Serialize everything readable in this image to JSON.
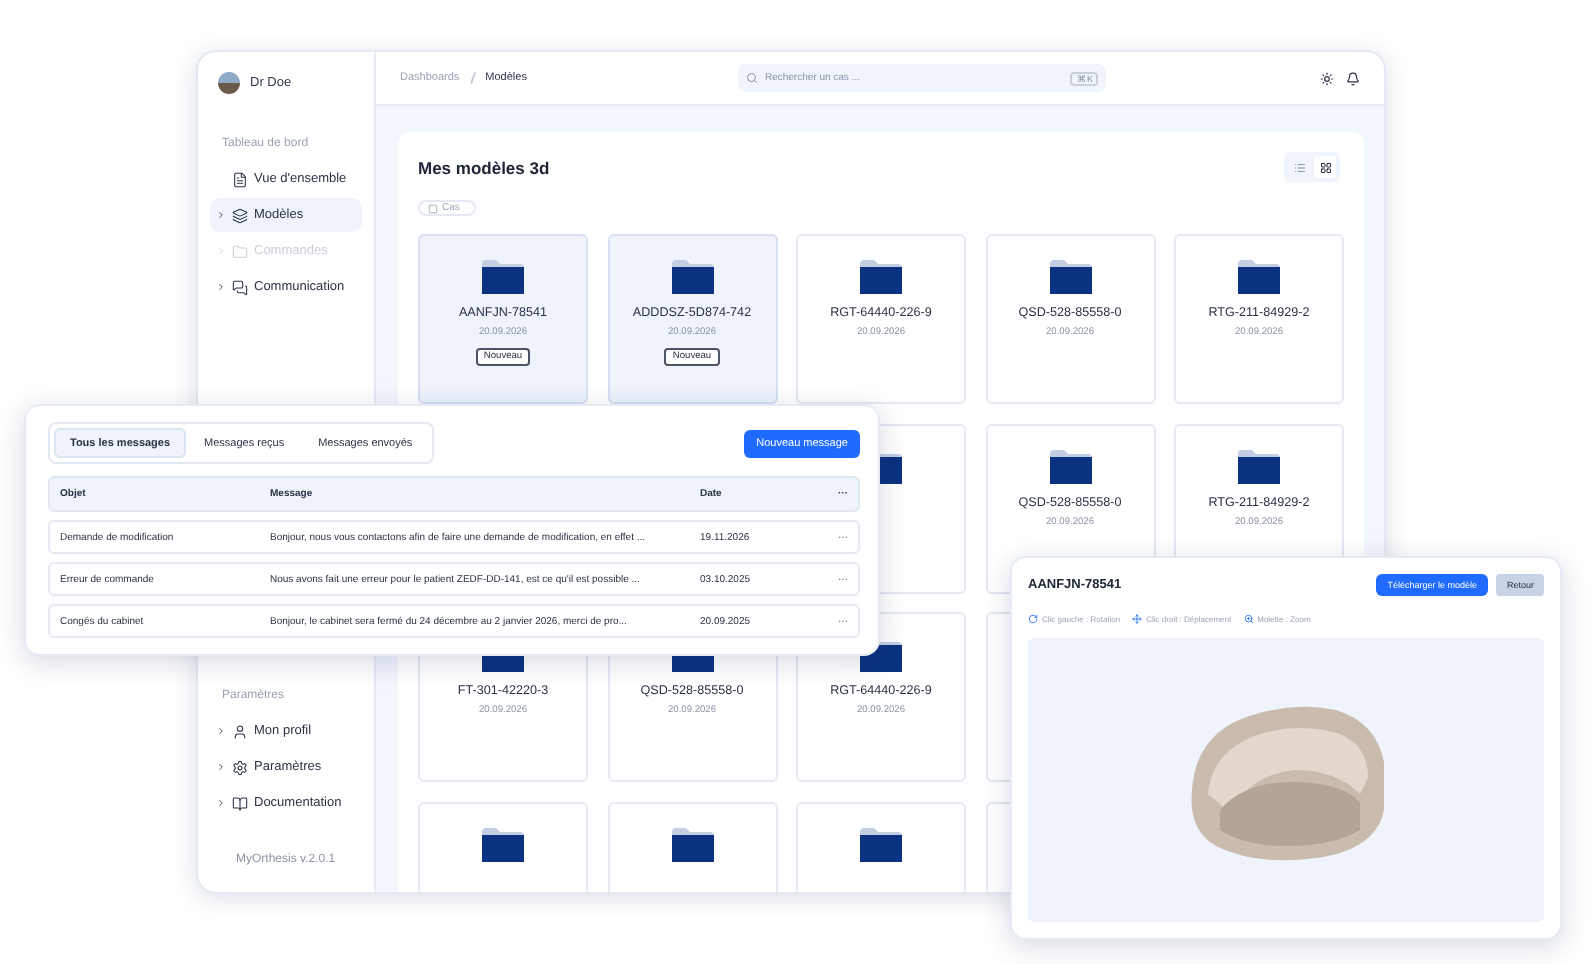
{
  "app": {
    "user": {
      "name": "Dr Doe"
    },
    "breadcrumb": [
      "Dashboards",
      "Modèles"
    ],
    "search": {
      "placeholder": "Rechercher un cas ...",
      "shortcut": "⌘K"
    },
    "sidebar": {
      "sections": [
        {
          "title": "Tableau de bord",
          "items": [
            {
              "label": "Vue d'ensemble",
              "expandable": false,
              "selected": false,
              "disabled": false
            },
            {
              "label": "Modèles",
              "expandable": true,
              "selected": true,
              "disabled": false
            },
            {
              "label": "Commandes",
              "expandable": true,
              "selected": false,
              "disabled": true
            },
            {
              "label": "Communication",
              "expandable": true,
              "selected": false,
              "disabled": false
            }
          ]
        },
        {
          "title": "Paramètres",
          "items": [
            {
              "label": "Mon profil",
              "expandable": true,
              "selected": false,
              "disabled": false
            },
            {
              "label": "Paramètres",
              "expandable": true,
              "selected": false,
              "disabled": false
            },
            {
              "label": "Documentation",
              "expandable": true,
              "selected": false,
              "disabled": false
            }
          ]
        }
      ],
      "version": "MyOrthesis v.2.0.1"
    },
    "content": {
      "title": "Mes modèles 3d",
      "view_toggle": [
        {
          "kind": "list",
          "selected": false
        },
        {
          "kind": "grid",
          "selected": true
        }
      ],
      "filter": {
        "label": "Cas",
        "checked": false
      },
      "cards": [
        {
          "name": "AANFJN-78541",
          "date": "20.09.2026",
          "selected": true,
          "badge": "Nouveau"
        },
        {
          "name": "ADDDSZ-5D874-742",
          "date": "20.09.2026",
          "selected": true,
          "badge": "Nouveau"
        },
        {
          "name": "RGT-64440-226-9",
          "date": "20.09.2026",
          "selected": false
        },
        {
          "name": "QSD-528-85558-0",
          "date": "20.09.2026",
          "selected": false
        },
        {
          "name": "RTG-211-84929-2",
          "date": "20.09.2026",
          "selected": false
        },
        {
          "selected": false
        },
        {
          "name": "QSD-528-85558-0",
          "date": "20.09.2026",
          "selected": false
        },
        {
          "name": "RTG-211-84929-2",
          "date": "20.09.2026",
          "selected": false
        },
        {
          "name": "FT-301-42220-3",
          "date": "20.09.2026",
          "selected": false
        },
        {
          "name": "QSD-528-85558-0",
          "date": "20.09.2026",
          "selected": false
        },
        {
          "name": "RGT-64440-226-9",
          "date": "20.09.2026",
          "selected": false
        },
        {
          "selected": false
        },
        {
          "selected": false
        },
        {
          "selected": false
        },
        {
          "selected": false
        },
        {
          "selected": false
        }
      ]
    }
  },
  "messages": {
    "tabs": [
      {
        "label": "Tous les messages",
        "selected": true
      },
      {
        "label": "Messages reçus",
        "selected": false
      },
      {
        "label": "Messages envoyés",
        "selected": false
      }
    ],
    "new_button": "Nouveau message",
    "columns": [
      "Objet",
      "Message",
      "Date",
      "···"
    ],
    "rows": [
      {
        "subject": "Demande de modification",
        "message": "Bonjour, nous vous contactons afin de faire une demande de modification, en effet ...",
        "date": "19.11.2026",
        "menu": "···"
      },
      {
        "subject": "Erreur de commande",
        "message": "Nous avons fait une erreur pour le patient ZEDF-DD-141, est ce qu'il est possible ...",
        "date": "03.10.2025",
        "menu": "···"
      },
      {
        "subject": "Congés du cabinet",
        "message": "Bonjour, le cabinet sera fermé du 24 décembre au 2 janvier 2026, merci de pro...",
        "date": "20.09.2025",
        "menu": "···"
      }
    ]
  },
  "viewer": {
    "title": "AANFJN-78541",
    "download_button": "Télécharger le modèle",
    "back_button": "Retour",
    "hints": [
      {
        "kind": "rotate",
        "text": "Clic gauche : Rotation"
      },
      {
        "kind": "move",
        "text": "Clic droit : Déplacement"
      },
      {
        "kind": "zoom",
        "text": "Molette : Zoom"
      }
    ]
  }
}
